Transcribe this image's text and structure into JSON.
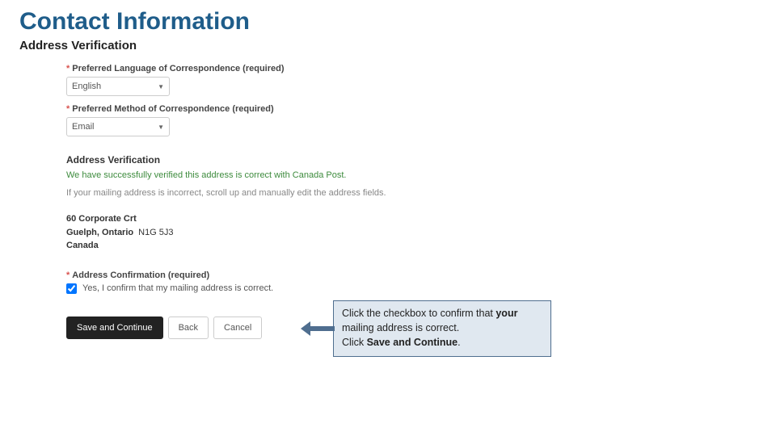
{
  "slide": {
    "title": "Contact Information",
    "subtitle": "Address Verification"
  },
  "form": {
    "lang_label": "Preferred Language of Correspondence (required)",
    "lang_value": "English",
    "method_label": "Preferred Method of Correspondence (required)",
    "method_value": "Email",
    "section_heading": "Address Verification",
    "verified_msg": "We have successfully verified this address is correct with Canada Post.",
    "help_text": "If your mailing address is incorrect, scroll up and manually edit the address fields.",
    "address": {
      "line1": "60 Corporate Crt",
      "city_province": "Guelph, Ontario",
      "postal": "N1G 5J3",
      "country": "Canada"
    },
    "confirm_label": "Address Confirmation (required)",
    "confirm_text": "Yes, I confirm that my mailing address is correct.",
    "buttons": {
      "save": "Save and Continue",
      "back": "Back",
      "cancel": "Cancel"
    }
  },
  "callout": {
    "line1a": "Click the checkbox to confirm that ",
    "line1b_bold": "your",
    "line1c": " mailing address is correct.",
    "line2a": "Click ",
    "line2b_bold": "Save and Continue",
    "line2c": "."
  }
}
